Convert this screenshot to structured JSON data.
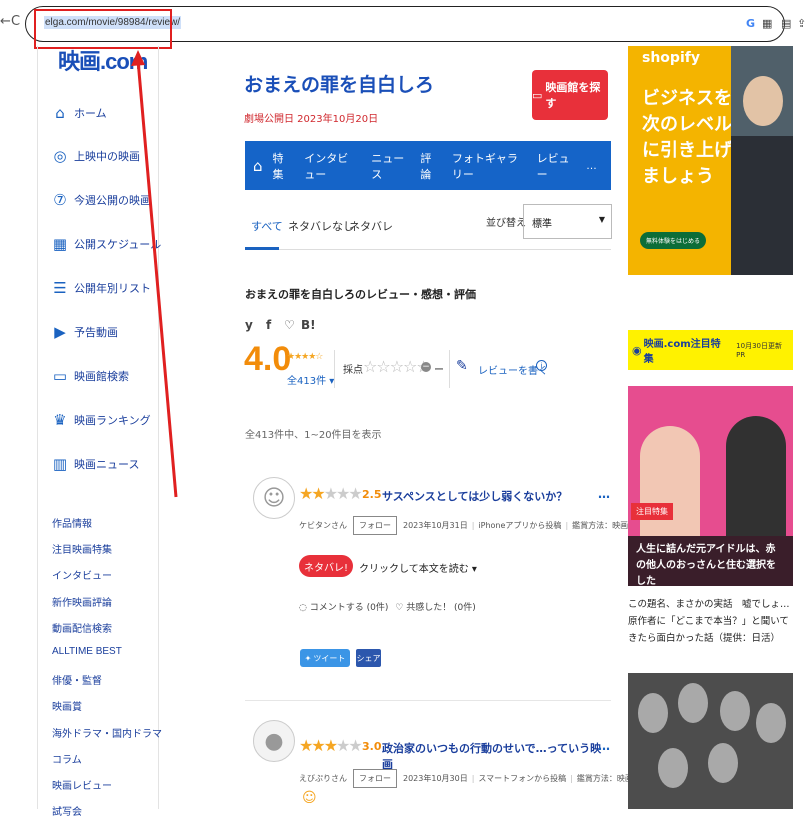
{
  "browser": {
    "back": "←",
    "reload": "C",
    "url": "elga.com/movie/98984/review/",
    "icons": [
      "G",
      "translate-icon",
      "reader-icon",
      "share-icon"
    ]
  },
  "sidebar": {
    "logo": "映画.com",
    "nav": [
      {
        "icon": "home-icon",
        "label": "ホーム"
      },
      {
        "icon": "film-reel-icon",
        "label": "上映中の映画"
      },
      {
        "icon": "seven-icon",
        "label": "今週公開の映画"
      },
      {
        "icon": "calendar-icon",
        "label": "公開スケジュール"
      },
      {
        "icon": "list-icon",
        "label": "公開年別リスト"
      },
      {
        "icon": "play-icon",
        "label": "予告動画"
      },
      {
        "icon": "theater-icon",
        "label": "映画館検索"
      },
      {
        "icon": "ranking-icon",
        "label": "映画ランキング"
      },
      {
        "icon": "news-icon",
        "label": "映画ニュース"
      }
    ],
    "links": [
      "作品情報",
      "注目映画特集",
      "インタビュー",
      "新作映画評論",
      "動画配信検索",
      "ALLTIME BEST",
      "俳優・監督",
      "映画賞",
      "海外ドラマ・国内ドラマ",
      "コラム",
      "映画レビュー",
      "試写会"
    ]
  },
  "movie": {
    "title": "おまえの罪を自白しろ",
    "release": "劇場公開日 2023年10月20日",
    "theater_button": "映画館を探す"
  },
  "bluenav": {
    "items": [
      "特集",
      "インタビュー",
      "ニュース",
      "評論",
      "フォトギャラリー",
      "レビュー",
      "…"
    ]
  },
  "tabs": {
    "items": [
      "すべて",
      "ネタバレなし",
      "ネタバレ"
    ],
    "sort_label": "並び替え",
    "sort_value": "標準"
  },
  "reviews_header": {
    "heading": "おまえの罪を自白しろのレビュー・感想・評価",
    "share": [
      "y",
      "f",
      "♡",
      "B!"
    ],
    "score": "4.0",
    "score_stars": "★★★★☆",
    "count": "全413件 ▾",
    "rate_label": "採点",
    "rate_stars": "☆☆☆☆☆",
    "rate_dash": "ー",
    "write": "レビューを書く",
    "range": "全413件中、1~20件目を表示"
  },
  "reviews": [
    {
      "stars_on": "★★",
      "stars_off": "★★★",
      "score": "2.5",
      "title": "サスペンスとしては少し弱くないか？",
      "user": "ケビタンさん",
      "follow": "フォロー",
      "date": "2023年10月31日",
      "device": "iPhoneアプリから投稿",
      "method": "鑑賞方法：映画館",
      "spoiler": "ネタバレ!",
      "spoiler_link": "クリックして本文を読む ▾",
      "comment": "コメントする (0件)",
      "like": "共感した！ (0件)",
      "tweet": "ツイート",
      "share": "シェア"
    },
    {
      "stars_on": "★★★",
      "stars_off": "★★",
      "score": "3.0",
      "title": "政治家のいつもの行動のせいで…っていう映画",
      "user": "えびぷりさん",
      "follow": "フォロー",
      "date": "2023年10月30日",
      "device": "スマートフォンから投稿",
      "method": "鑑賞方法：映画館"
    }
  ],
  "right": {
    "ad_brand": "shopify",
    "ad_copy": "ビジネスを次のレベルに引き上げましょう",
    "ad_cta": "無料体験をはじめる",
    "feature_title": "映画.com注目特集",
    "feature_date": "10月30日更新 PR",
    "feature_badge": "注目特集",
    "feature_caption": "人生に詰んだ元アイドルは、赤の他人のおっさんと住む選択をした",
    "feature_text": "この題名、まさかの実話　嘘でしょ…原作者に「どこまで本当？」と聞いてきたら面白かった話（提供：日活）"
  },
  "colors": {
    "brand_blue": "#1564c8",
    "accent_red": "#e8303a",
    "score_orange": "#f28c0a",
    "feature_yellow": "#fff200"
  }
}
